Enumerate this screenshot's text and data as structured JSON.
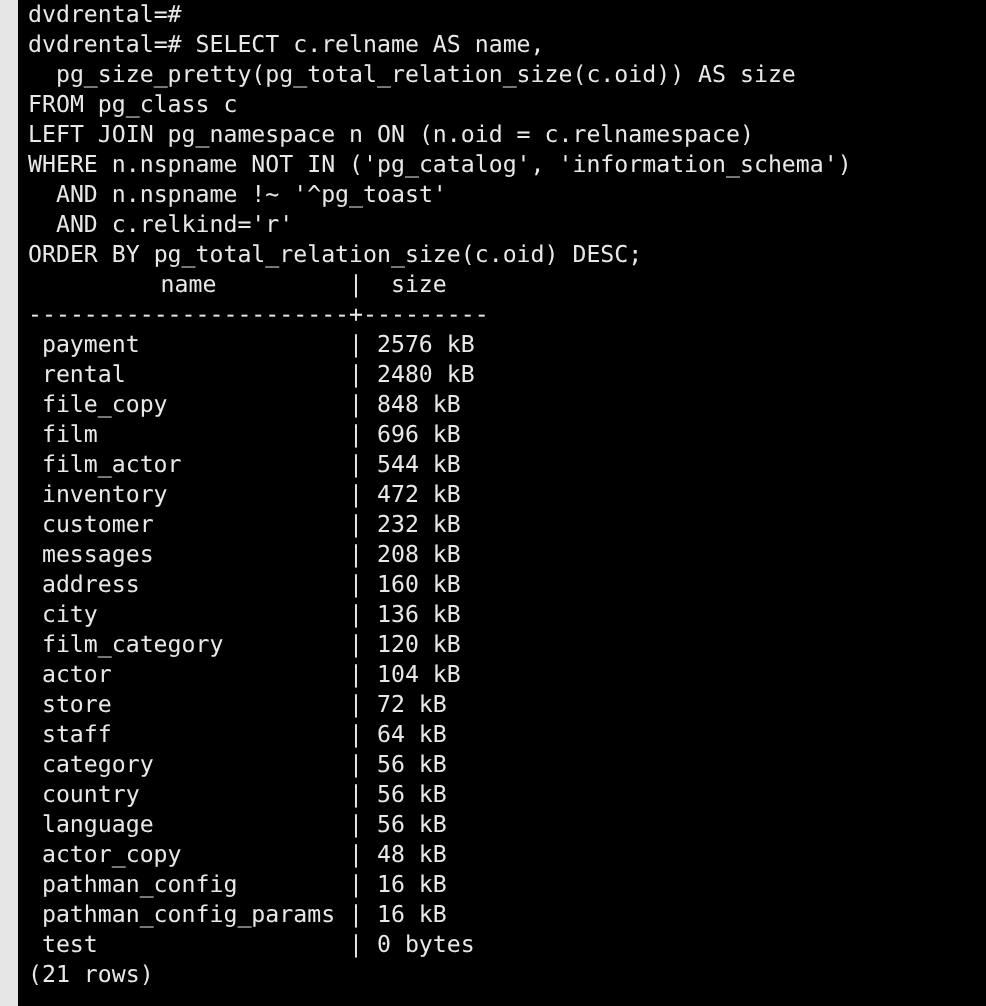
{
  "terminal": {
    "prompt_line": "dvdrental=#",
    "query_lines": [
      "dvdrental=# SELECT c.relname AS name,",
      "  pg_size_pretty(pg_total_relation_size(c.oid)) AS size",
      "FROM pg_class c",
      "LEFT JOIN pg_namespace n ON (n.oid = c.relnamespace)",
      "WHERE n.nspname NOT IN ('pg_catalog', 'information_schema')",
      "  AND n.nspname !~ '^pg_toast'",
      "  AND c.relkind='r'",
      "ORDER BY pg_total_relation_size(c.oid) DESC;"
    ],
    "result": {
      "columns": [
        "name",
        "size"
      ],
      "column_separator": "|",
      "header_rule": "-----------------------+---------",
      "rows": [
        {
          "name": "payment",
          "size": "2576 kB"
        },
        {
          "name": "rental",
          "size": "2480 kB"
        },
        {
          "name": "file_copy",
          "size": "848 kB"
        },
        {
          "name": "film",
          "size": "696 kB"
        },
        {
          "name": "film_actor",
          "size": "544 kB"
        },
        {
          "name": "inventory",
          "size": "472 kB"
        },
        {
          "name": "customer",
          "size": "232 kB"
        },
        {
          "name": "messages",
          "size": "208 kB"
        },
        {
          "name": "address",
          "size": "160 kB"
        },
        {
          "name": "city",
          "size": "136 kB"
        },
        {
          "name": "film_category",
          "size": "120 kB"
        },
        {
          "name": "actor",
          "size": "104 kB"
        },
        {
          "name": "store",
          "size": "72 kB"
        },
        {
          "name": "staff",
          "size": "64 kB"
        },
        {
          "name": "category",
          "size": "56 kB"
        },
        {
          "name": "country",
          "size": "56 kB"
        },
        {
          "name": "language",
          "size": "56 kB"
        },
        {
          "name": "actor_copy",
          "size": "48 kB"
        },
        {
          "name": "pathman_config",
          "size": "16 kB"
        },
        {
          "name": "pathman_config_params",
          "size": "16 kB"
        },
        {
          "name": "test",
          "size": "0 bytes"
        }
      ],
      "footer": "(21 rows)"
    }
  }
}
